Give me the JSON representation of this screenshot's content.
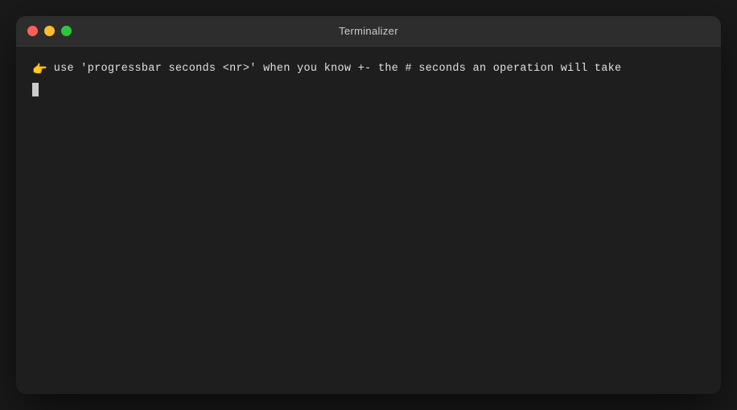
{
  "window": {
    "title": "Terminalizer",
    "controls": {
      "close_label": "close",
      "minimize_label": "minimize",
      "maximize_label": "maximize"
    },
    "colors": {
      "close": "#ff5f56",
      "minimize": "#ffbd2e",
      "maximize": "#27c93f",
      "background": "#1e1e1e",
      "titlebar": "#2d2d2d",
      "text": "#e0e0e0"
    }
  },
  "terminal": {
    "prompt_emoji": "👉",
    "line1": "use 'progressbar seconds <nr>' when you know +- the # seconds an operation will take",
    "cursor_visible": true
  }
}
